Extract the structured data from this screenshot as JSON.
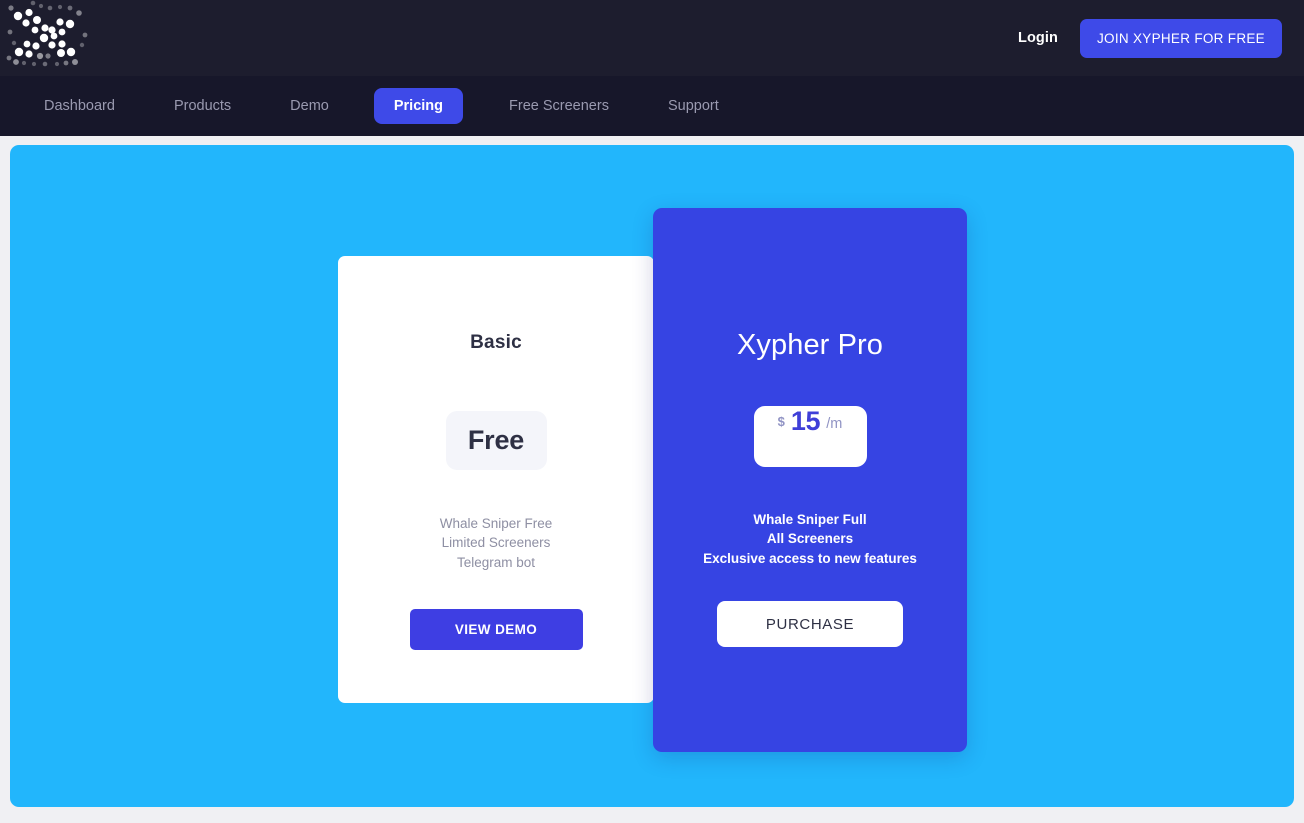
{
  "header": {
    "logo_name": "xypher-dotted-x-logo",
    "login_label": "Login",
    "join_label": "JOIN XYPHER FOR FREE",
    "bg_color": "#1d1d2e",
    "accent_color": "#3e4ae8"
  },
  "nav": {
    "bg_color": "#17172a",
    "active_color": "#3e4ae8",
    "items": [
      {
        "label": "Dashboard",
        "active": false
      },
      {
        "label": "Products",
        "active": false
      },
      {
        "label": "Demo",
        "active": false
      },
      {
        "label": "Pricing",
        "active": true
      },
      {
        "label": "Free Screeners",
        "active": false
      },
      {
        "label": "Support",
        "active": false
      }
    ]
  },
  "panel": {
    "bg_color": "#22b6fc"
  },
  "plans": {
    "basic": {
      "title": "Basic",
      "price_text": "Free",
      "features": [
        "Whale Sniper Free",
        "Limited Screeners",
        "Telegram bot"
      ],
      "cta_label": "VIEW DEMO",
      "card_color": "#ffffff",
      "cta_color": "#3e3ee3"
    },
    "pro": {
      "title": "Xypher Pro",
      "currency": "$",
      "amount": "15",
      "period": "/m",
      "features": [
        "Whale Sniper Full",
        "All Screeners",
        "Exclusive access to new features"
      ],
      "cta_label": "PURCHASE",
      "card_color": "#3644e3",
      "cta_color": "#ffffff"
    }
  }
}
